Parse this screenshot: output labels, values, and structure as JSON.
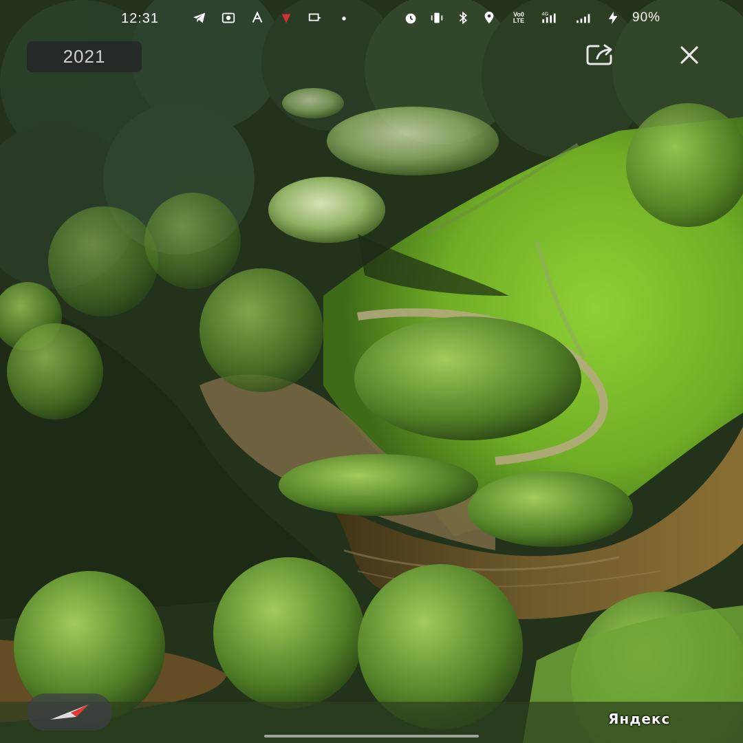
{
  "status_bar": {
    "time": "12:31",
    "left_icons": [
      "telegram-icon",
      "camera-app-icon",
      "font-a-icon",
      "notification-red-icon",
      "cast-icon",
      "dot-icon"
    ],
    "right_icons": [
      "alarm-icon",
      "vibrate-icon",
      "bluetooth-icon",
      "location-icon"
    ],
    "volte_label": "Vo0 LTE",
    "network_label": "4G",
    "battery": "90%"
  },
  "photo_viewer": {
    "year": "2021",
    "share_icon": "share-icon",
    "close_icon": "close-icon",
    "compass_icon": "compass-icon"
  },
  "watermark": {
    "text": "Яндекс"
  },
  "colors": {
    "badge_bg": "#232626",
    "river": "#6b5528",
    "meadow": "#7fbf2a",
    "forest_dark": "#1f2d17",
    "compass_red": "#e53935"
  }
}
